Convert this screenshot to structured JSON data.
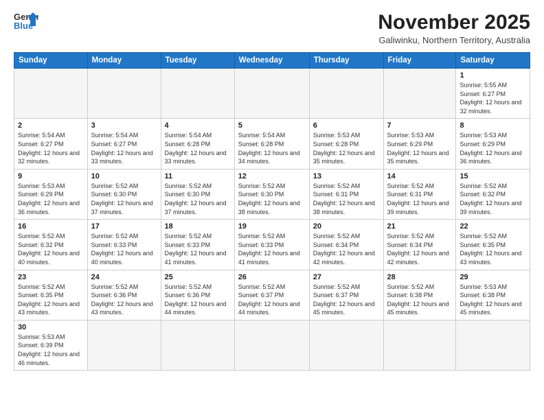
{
  "logo": {
    "line1": "General",
    "line2": "Blue"
  },
  "title": "November 2025",
  "subtitle": "Galiwinku, Northern Territory, Australia",
  "days_of_week": [
    "Sunday",
    "Monday",
    "Tuesday",
    "Wednesday",
    "Thursday",
    "Friday",
    "Saturday"
  ],
  "weeks": [
    [
      {
        "num": "",
        "info": ""
      },
      {
        "num": "",
        "info": ""
      },
      {
        "num": "",
        "info": ""
      },
      {
        "num": "",
        "info": ""
      },
      {
        "num": "",
        "info": ""
      },
      {
        "num": "",
        "info": ""
      },
      {
        "num": "1",
        "info": "Sunrise: 5:55 AM\nSunset: 6:27 PM\nDaylight: 12 hours\nand 32 minutes."
      }
    ],
    [
      {
        "num": "2",
        "info": "Sunrise: 5:54 AM\nSunset: 6:27 PM\nDaylight: 12 hours\nand 32 minutes."
      },
      {
        "num": "3",
        "info": "Sunrise: 5:54 AM\nSunset: 6:27 PM\nDaylight: 12 hours\nand 33 minutes."
      },
      {
        "num": "4",
        "info": "Sunrise: 5:54 AM\nSunset: 6:28 PM\nDaylight: 12 hours\nand 33 minutes."
      },
      {
        "num": "5",
        "info": "Sunrise: 5:54 AM\nSunset: 6:28 PM\nDaylight: 12 hours\nand 34 minutes."
      },
      {
        "num": "6",
        "info": "Sunrise: 5:53 AM\nSunset: 6:28 PM\nDaylight: 12 hours\nand 35 minutes."
      },
      {
        "num": "7",
        "info": "Sunrise: 5:53 AM\nSunset: 6:29 PM\nDaylight: 12 hours\nand 35 minutes."
      },
      {
        "num": "8",
        "info": "Sunrise: 5:53 AM\nSunset: 6:29 PM\nDaylight: 12 hours\nand 36 minutes."
      }
    ],
    [
      {
        "num": "9",
        "info": "Sunrise: 5:53 AM\nSunset: 6:29 PM\nDaylight: 12 hours\nand 36 minutes."
      },
      {
        "num": "10",
        "info": "Sunrise: 5:52 AM\nSunset: 6:30 PM\nDaylight: 12 hours\nand 37 minutes."
      },
      {
        "num": "11",
        "info": "Sunrise: 5:52 AM\nSunset: 6:30 PM\nDaylight: 12 hours\nand 37 minutes."
      },
      {
        "num": "12",
        "info": "Sunrise: 5:52 AM\nSunset: 6:30 PM\nDaylight: 12 hours\nand 38 minutes."
      },
      {
        "num": "13",
        "info": "Sunrise: 5:52 AM\nSunset: 6:31 PM\nDaylight: 12 hours\nand 38 minutes."
      },
      {
        "num": "14",
        "info": "Sunrise: 5:52 AM\nSunset: 6:31 PM\nDaylight: 12 hours\nand 39 minutes."
      },
      {
        "num": "15",
        "info": "Sunrise: 5:52 AM\nSunset: 6:32 PM\nDaylight: 12 hours\nand 39 minutes."
      }
    ],
    [
      {
        "num": "16",
        "info": "Sunrise: 5:52 AM\nSunset: 6:32 PM\nDaylight: 12 hours\nand 40 minutes."
      },
      {
        "num": "17",
        "info": "Sunrise: 5:52 AM\nSunset: 6:33 PM\nDaylight: 12 hours\nand 40 minutes."
      },
      {
        "num": "18",
        "info": "Sunrise: 5:52 AM\nSunset: 6:33 PM\nDaylight: 12 hours\nand 41 minutes."
      },
      {
        "num": "19",
        "info": "Sunrise: 5:52 AM\nSunset: 6:33 PM\nDaylight: 12 hours\nand 41 minutes."
      },
      {
        "num": "20",
        "info": "Sunrise: 5:52 AM\nSunset: 6:34 PM\nDaylight: 12 hours\nand 42 minutes."
      },
      {
        "num": "21",
        "info": "Sunrise: 5:52 AM\nSunset: 6:34 PM\nDaylight: 12 hours\nand 42 minutes."
      },
      {
        "num": "22",
        "info": "Sunrise: 5:52 AM\nSunset: 6:35 PM\nDaylight: 12 hours\nand 43 minutes."
      }
    ],
    [
      {
        "num": "23",
        "info": "Sunrise: 5:52 AM\nSunset: 6:35 PM\nDaylight: 12 hours\nand 43 minutes."
      },
      {
        "num": "24",
        "info": "Sunrise: 5:52 AM\nSunset: 6:36 PM\nDaylight: 12 hours\nand 43 minutes."
      },
      {
        "num": "25",
        "info": "Sunrise: 5:52 AM\nSunset: 6:36 PM\nDaylight: 12 hours\nand 44 minutes."
      },
      {
        "num": "26",
        "info": "Sunrise: 5:52 AM\nSunset: 6:37 PM\nDaylight: 12 hours\nand 44 minutes."
      },
      {
        "num": "27",
        "info": "Sunrise: 5:52 AM\nSunset: 6:37 PM\nDaylight: 12 hours\nand 45 minutes."
      },
      {
        "num": "28",
        "info": "Sunrise: 5:52 AM\nSunset: 6:38 PM\nDaylight: 12 hours\nand 45 minutes."
      },
      {
        "num": "29",
        "info": "Sunrise: 5:53 AM\nSunset: 6:38 PM\nDaylight: 12 hours\nand 45 minutes."
      }
    ],
    [
      {
        "num": "30",
        "info": "Sunrise: 5:53 AM\nSunset: 6:39 PM\nDaylight: 12 hours\nand 46 minutes."
      },
      {
        "num": "",
        "info": ""
      },
      {
        "num": "",
        "info": ""
      },
      {
        "num": "",
        "info": ""
      },
      {
        "num": "",
        "info": ""
      },
      {
        "num": "",
        "info": ""
      },
      {
        "num": "",
        "info": ""
      }
    ]
  ]
}
